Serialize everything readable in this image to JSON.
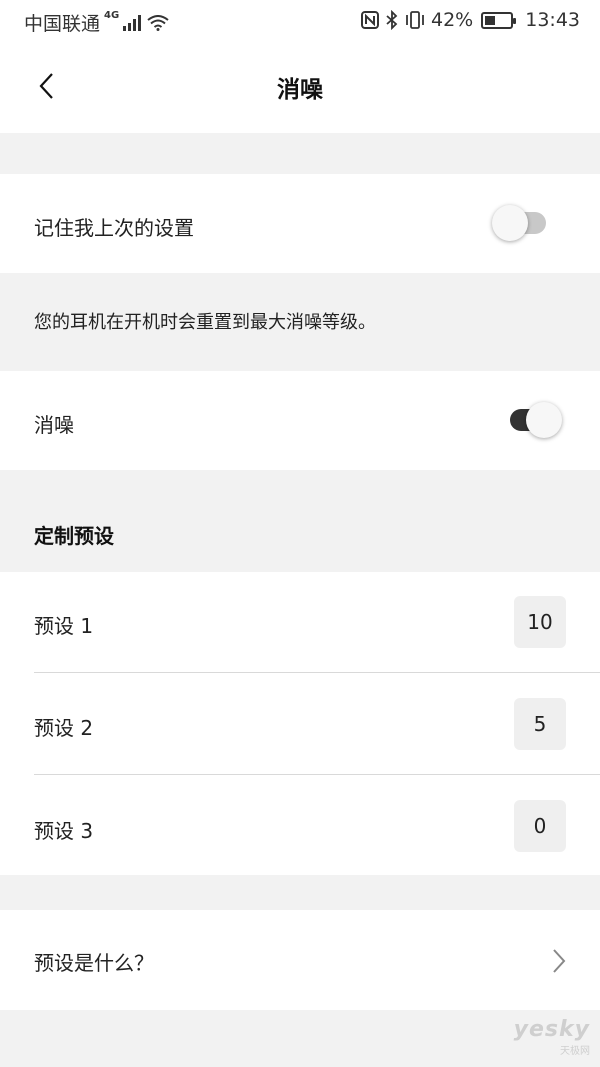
{
  "status_bar": {
    "carrier": "中国联通",
    "network_type": "4G",
    "battery_text": "42%",
    "battery_level": 0.42,
    "time": "13:43",
    "icons": [
      "signal-bars-icon",
      "wifi-icon",
      "nfc-icon",
      "bluetooth-icon",
      "vibrate-icon",
      "battery-icon"
    ]
  },
  "header": {
    "back_icon": "chevron-left-icon",
    "title": "消噪"
  },
  "remember_setting": {
    "label": "记住我上次的设置",
    "enabled": false
  },
  "info": {
    "text": "您的耳机在开机时会重置到最大消噪等级。"
  },
  "noise_cancel": {
    "label": "消噪",
    "enabled": true
  },
  "presets": {
    "section_title": "定制预设",
    "items": [
      {
        "label": "预设 1",
        "value": "10"
      },
      {
        "label": "预设 2",
        "value": "5"
      },
      {
        "label": "预设 3",
        "value": "0"
      }
    ]
  },
  "help": {
    "label": "预设是什么？",
    "icon": "chevron-right-icon"
  },
  "watermark": {
    "logo": "yesky",
    "sub": "天极网"
  },
  "colors": {
    "background": "#f2f2f2",
    "card": "#ffffff",
    "toggle_on": "#333333",
    "toggle_off": "#c8c8c8",
    "value_box": "#efefef"
  }
}
